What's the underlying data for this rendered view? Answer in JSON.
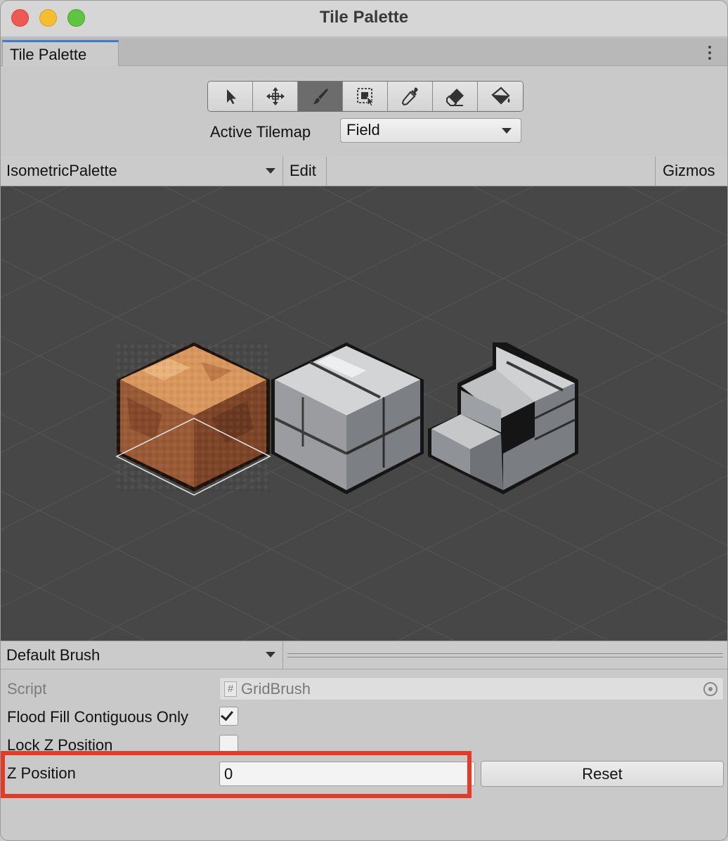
{
  "window": {
    "title": "Tile Palette"
  },
  "tab": {
    "label": "Tile Palette"
  },
  "tools": [
    {
      "name": "select-tool",
      "icon": "arrow-pointer-icon",
      "active": false
    },
    {
      "name": "move-tool",
      "icon": "move-arrows-icon",
      "active": false
    },
    {
      "name": "paint-tool",
      "icon": "paintbrush-icon",
      "active": true
    },
    {
      "name": "box-fill-tool",
      "icon": "box-select-icon",
      "active": false
    },
    {
      "name": "pick-tool",
      "icon": "eyedropper-icon",
      "active": false
    },
    {
      "name": "erase-tool",
      "icon": "eraser-icon",
      "active": false
    },
    {
      "name": "fill-tool",
      "icon": "paint-bucket-icon",
      "active": false
    }
  ],
  "active_tilemap": {
    "label": "Active Tilemap",
    "value": "Field"
  },
  "palette": {
    "selected": "IsometricPalette",
    "edit_label": "Edit",
    "gizmos_label": "Gizmos"
  },
  "tiles": [
    {
      "name": "dirt-block-tile",
      "color": "#b5764a"
    },
    {
      "name": "stone-block-tile",
      "color": "#9ea0a2"
    },
    {
      "name": "stone-steps-tile",
      "color": "#8c8f93"
    }
  ],
  "brush": {
    "selected": "Default Brush",
    "script_label": "Script",
    "script_value": "GridBrush",
    "flood_fill_label": "Flood Fill Contiguous Only",
    "flood_fill_checked": true,
    "lock_z_label": "Lock Z Position",
    "lock_z_checked": false,
    "z_position_label": "Z Position",
    "z_position_value": "0",
    "reset_label": "Reset"
  },
  "colors": {
    "highlight": "#e33b27",
    "active_tab_accent": "#3d7bd4",
    "canvas_bg": "#474747"
  }
}
